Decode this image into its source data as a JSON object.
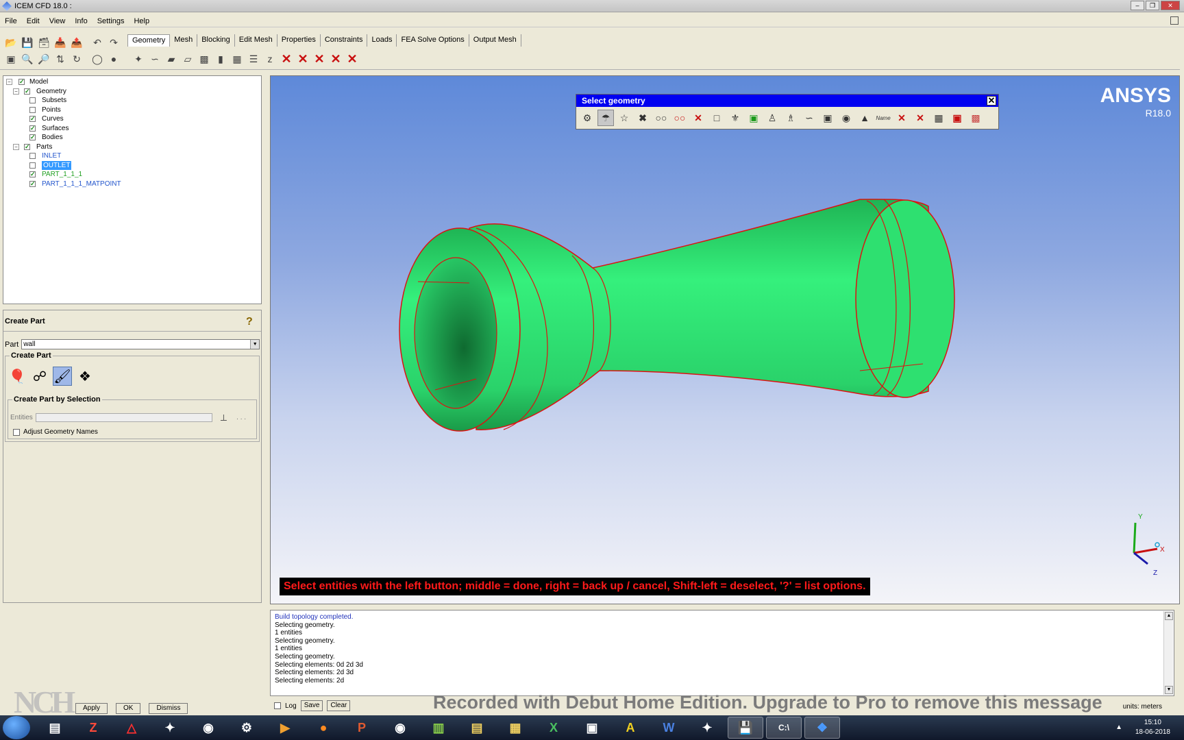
{
  "window": {
    "title": "ICEM CFD 18.0 :"
  },
  "menu": [
    "File",
    "Edit",
    "View",
    "Info",
    "Settings",
    "Help"
  ],
  "tabs": [
    "Geometry",
    "Mesh",
    "Blocking",
    "Edit Mesh",
    "Properties",
    "Constraints",
    "Loads",
    "FEA Solve Options",
    "Output Mesh"
  ],
  "active_tab": "Geometry",
  "tree": {
    "model": "Model",
    "geometry": "Geometry",
    "subsets": "Subsets",
    "points": "Points",
    "curves": "Curves",
    "surfaces": "Surfaces",
    "bodies": "Bodies",
    "parts": "Parts",
    "inlet": "INLET",
    "outlet": "OUTLET",
    "part_1_1_1": "PART_1_1_1",
    "part_matpoint": "PART_1_1_1_MATPOINT"
  },
  "panel": {
    "title": "Create Part",
    "part_label": "Part",
    "part_value": "wall",
    "group_title": "Create Part",
    "sub_group_title": "Create Part by Selection",
    "entities_label": "Entities",
    "entities_dots": ". . .",
    "adjust_label": "Adjust Geometry Names"
  },
  "buttons": {
    "apply": "Apply",
    "ok": "OK",
    "dismiss": "Dismiss"
  },
  "viewport": {
    "brand": "ANSYS",
    "version": "R18.0",
    "select_title": "Select geometry",
    "select_name_icon": "Name",
    "prompt": "Select entities with the left button; middle = done, right = back up / cancel, Shift-left = deselect, '?' = list options.",
    "axis_y": "Y",
    "axis_x": "X",
    "axis_z": "Z",
    "model_color": "#33ee77",
    "edge_color": "#dd1111"
  },
  "messages": [
    "Build topology completed.",
    "Selecting geometry.",
    "1 entities",
    "Selecting geometry.",
    "1 entities",
    "Selecting geometry.",
    "Selecting elements: 0d 2d 3d",
    "Selecting elements: 2d 3d",
    "Selecting elements: 2d"
  ],
  "msg_controls": {
    "log": "Log",
    "save": "Save",
    "clear": "Clear"
  },
  "units": "units: meters",
  "watermark": "Recorded with Debut Home Edition. Upgrade to Pro to remove this message",
  "nch_logo": "NCH",
  "taskbar": {
    "time": "15:10",
    "date": "18-06-2018"
  }
}
